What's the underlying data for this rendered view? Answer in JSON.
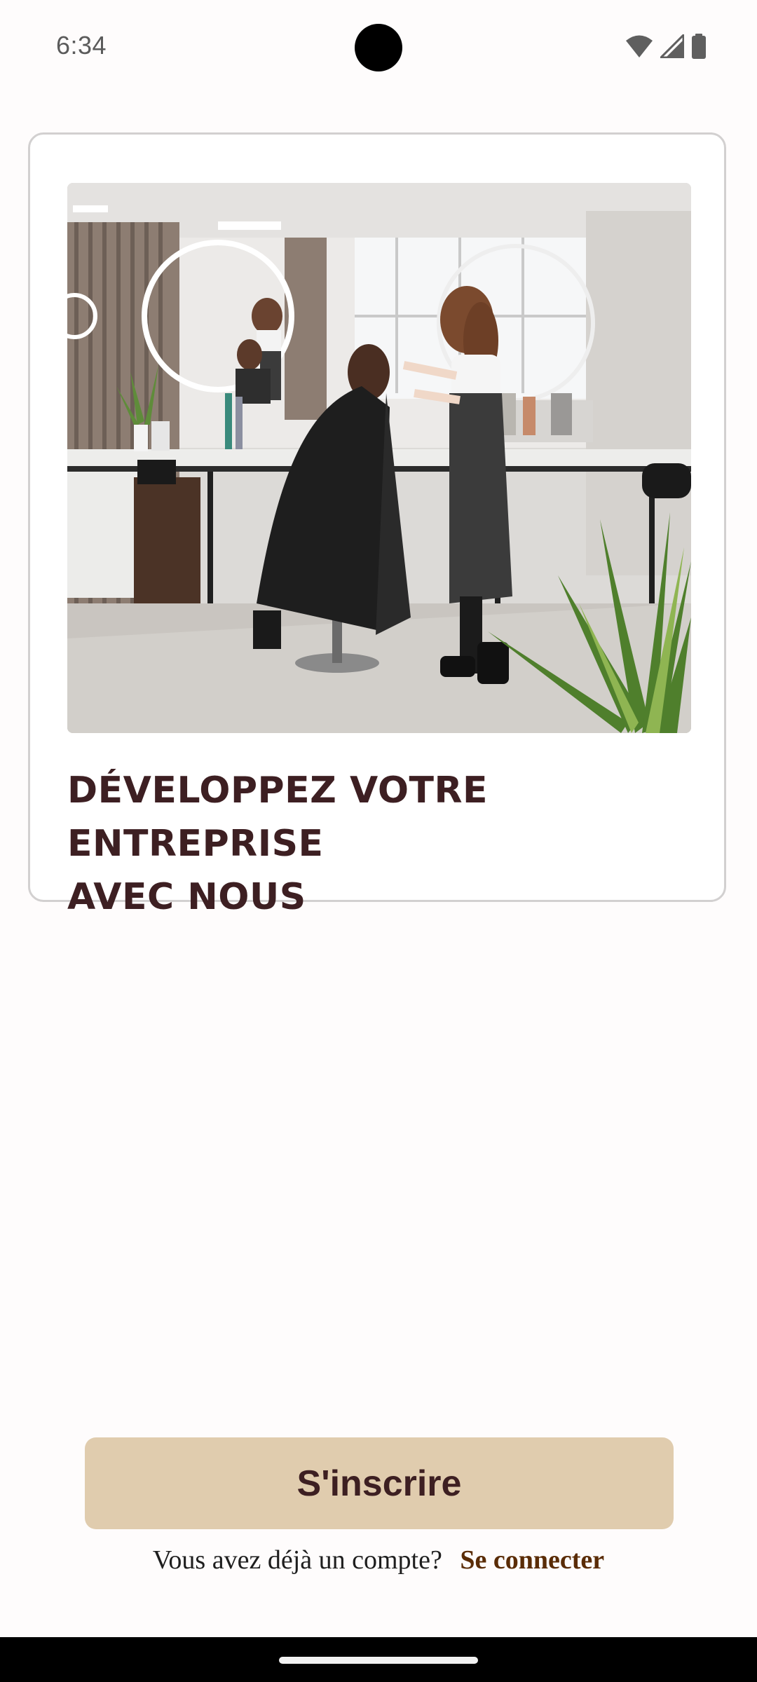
{
  "status_bar": {
    "time": "6:34",
    "icons": [
      "wifi-icon",
      "cellular-signal-icon",
      "battery-icon"
    ]
  },
  "card": {
    "image": {
      "description_icon": "hair-salon-photo"
    },
    "title_line1": "DÉVELOPPEZ VOTRE ENTREPRISE",
    "title_line2": "AVEC NOUS"
  },
  "actions": {
    "signup_label": "S'inscrire",
    "login_prompt": "Vous avez déjà un compte?",
    "login_link": "Se connecter"
  },
  "colors": {
    "accent_button": "#e0ccae",
    "title_text": "#3d1f22",
    "link_text": "#5a2c06",
    "card_border": "#d2d0d0"
  }
}
